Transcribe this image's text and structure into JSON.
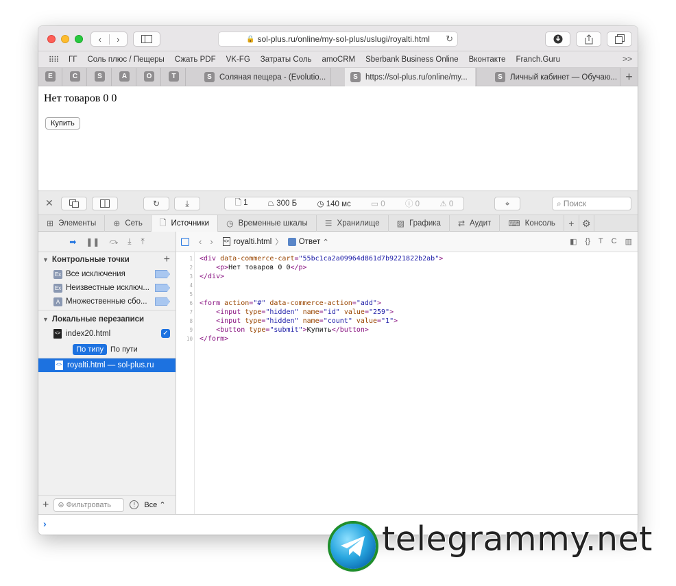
{
  "browser": {
    "url": "sol-plus.ru/online/my-sol-plus/uslugi/royalti.html",
    "bookmarks": [
      "ГГ",
      "Соль плюс / Пещеры",
      "Сжать PDF",
      "VK-FG",
      "Затраты Соль",
      "amoCRM",
      "Sberbank Business Online",
      "Вконтакте",
      "Franch.Guru"
    ],
    "bookmarks_more": ">>",
    "pinned_tabs": [
      "E",
      "C",
      "S",
      "A",
      "O",
      "T"
    ],
    "tabs": [
      {
        "favicon": "S",
        "title": "Соляная пещера - (Evolutio..."
      },
      {
        "favicon": "S",
        "title": "https://sol-plus.ru/online/my..."
      },
      {
        "favicon": "S",
        "title": "Личный кабинет — Обучаю..."
      }
    ],
    "new_tab": "+"
  },
  "page": {
    "text": "Нет товаров 0 0",
    "buy_button": "Купить"
  },
  "devtools": {
    "stats": {
      "resources": "1",
      "size": "300 Б",
      "time": "140 мс",
      "logs": "0",
      "errors": "0",
      "warnings": "0"
    },
    "search_placeholder": "Поиск",
    "tabs": [
      "Элементы",
      "Сеть",
      "Источники",
      "Временные шкалы",
      "Хранилище",
      "Графика",
      "Аудит",
      "Консоль"
    ],
    "active_tab": "Источники",
    "sidebar": {
      "breakpoints_title": "Контрольные точки",
      "breakpoints": [
        {
          "badge": "Ex",
          "label": "Все исключения"
        },
        {
          "badge": "Ex",
          "label": "Неизвестные исключ..."
        },
        {
          "badge": "A",
          "label": "Множественные сбо..."
        }
      ],
      "overrides_title": "Локальные перезаписи",
      "override_file": "index20.html",
      "group_by_type": "По типу",
      "group_by_path": "По пути",
      "resource": "royalti.html — sol-plus.ru",
      "filter_placeholder": "Фильтровать",
      "scope": "Все"
    },
    "code_header": {
      "file": "royalti.html",
      "response": "Ответ"
    },
    "code_lines": [
      {
        "n": "1",
        "html": "<span class=\"tag\">&lt;div </span><span class=\"attr\">data-commerce-cart</span><span class=\"tag\">=</span><span class=\"val\">\"55bc1ca2a09964d861d7b9221822b2ab\"</span><span class=\"tag\">&gt;</span>"
      },
      {
        "n": "2",
        "html": "    <span class=\"tag\">&lt;p&gt;</span>Нет товаров 0 0<span class=\"tag\">&lt;/p&gt;</span>"
      },
      {
        "n": "3",
        "html": "<span class=\"tag\">&lt;/div&gt;</span>"
      },
      {
        "n": "4",
        "html": ""
      },
      {
        "n": "5",
        "html": ""
      },
      {
        "n": "6",
        "html": "<span class=\"tag\">&lt;form </span><span class=\"attr\">action</span><span class=\"tag\">=</span><span class=\"val\">\"#\"</span> <span class=\"attr\">data-commerce-action</span><span class=\"tag\">=</span><span class=\"val\">\"add\"</span><span class=\"tag\">&gt;</span>"
      },
      {
        "n": "7",
        "html": "    <span class=\"tag\">&lt;input </span><span class=\"attr\">type</span><span class=\"tag\">=</span><span class=\"val\">\"hidden\"</span> <span class=\"attr\">name</span><span class=\"tag\">=</span><span class=\"val\">\"id\"</span> <span class=\"attr\">value</span><span class=\"tag\">=</span><span class=\"val\">\"259\"</span><span class=\"tag\">&gt;</span>"
      },
      {
        "n": "8",
        "html": "    <span class=\"tag\">&lt;input </span><span class=\"attr\">type</span><span class=\"tag\">=</span><span class=\"val\">\"hidden\"</span> <span class=\"attr\">name</span><span class=\"tag\">=</span><span class=\"val\">\"count\"</span> <span class=\"attr\">value</span><span class=\"tag\">=</span><span class=\"val\">\"1\"</span><span class=\"tag\">&gt;</span>"
      },
      {
        "n": "9",
        "html": "    <span class=\"tag\">&lt;button </span><span class=\"attr\">type</span><span class=\"tag\">=</span><span class=\"val\">\"submit\"</span><span class=\"tag\">&gt;</span>Купить<span class=\"tag\">&lt;/button&gt;</span>"
      },
      {
        "n": "10",
        "html": "<span class=\"tag\">&lt;/form&gt;</span>"
      }
    ]
  },
  "watermark": {
    "text": "telegrammy.net"
  },
  "colors": {
    "accent": "#1d72e0",
    "tag": "#881280",
    "attr": "#994500",
    "value": "#1a1aa6"
  }
}
